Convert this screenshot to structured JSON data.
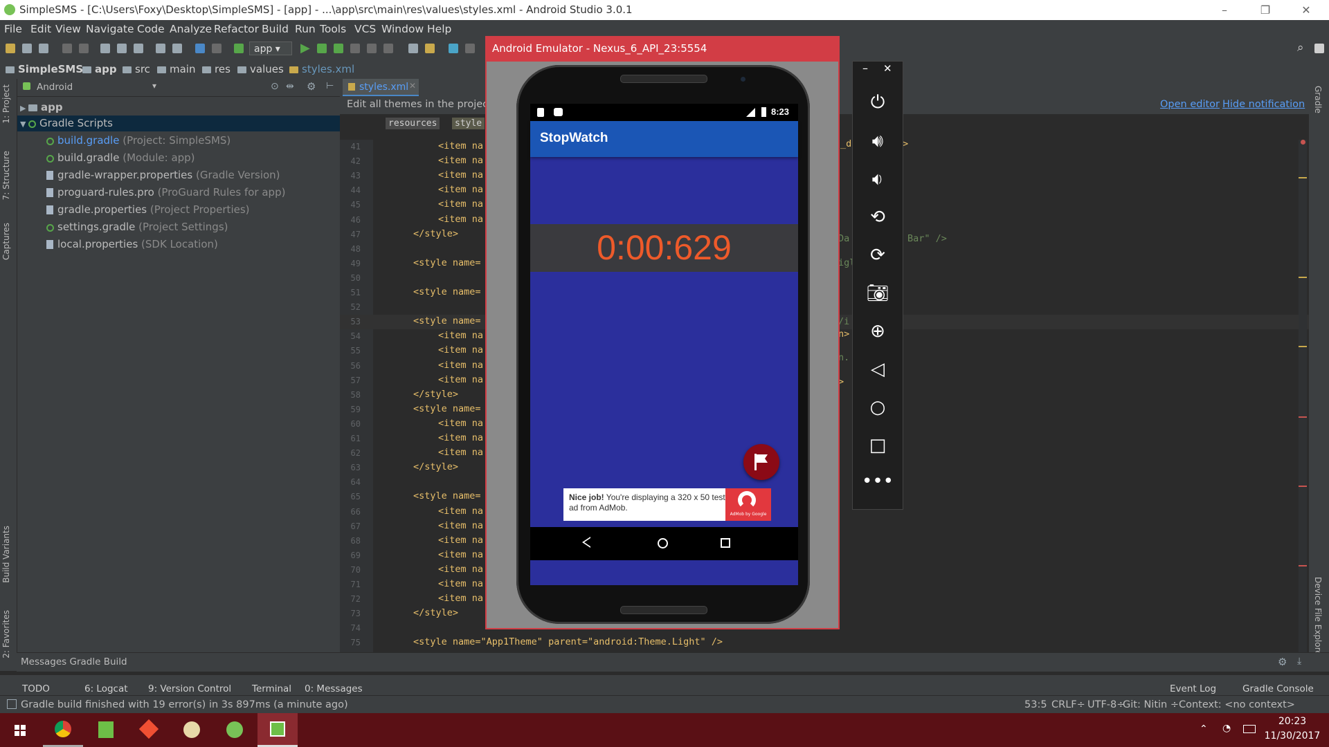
{
  "window": {
    "title": "SimpleSMS - [C:\\Users\\Foxy\\Desktop\\SimpleSMS] - [app] - ...\\app\\src\\main\\res\\values\\styles.xml - Android Studio 3.0.1",
    "minimize": "–",
    "maximize": "❐",
    "close": "✕"
  },
  "menu": [
    "File",
    "Edit",
    "View",
    "Navigate",
    "Code",
    "Analyze",
    "Refactor",
    "Build",
    "Run",
    "Tools",
    "VCS",
    "Window",
    "Help"
  ],
  "toolbar": {
    "run_config": "app"
  },
  "breadcrumb": [
    "SimpleSMS",
    "app",
    "src",
    "main",
    "res",
    "values",
    "styles.xml"
  ],
  "left_tabs": [
    "1: Project",
    "7: Structure",
    "Captures",
    "Build Variants",
    "2: Favorites"
  ],
  "right_tabs": [
    "Gradle",
    "Device File Explorer"
  ],
  "project": {
    "view": "Android",
    "tree": [
      {
        "label": "app",
        "hint": ""
      },
      {
        "label": "Gradle Scripts",
        "hint": ""
      },
      {
        "label": "build.gradle",
        "hint": "(Project: SimpleSMS)"
      },
      {
        "label": "build.gradle",
        "hint": "(Module: app)"
      },
      {
        "label": "gradle-wrapper.properties",
        "hint": "(Gradle Version)"
      },
      {
        "label": "proguard-rules.pro",
        "hint": "(ProGuard Rules for app)"
      },
      {
        "label": "gradle.properties",
        "hint": "(Project Properties)"
      },
      {
        "label": "settings.gradle",
        "hint": "(Project Settings)"
      },
      {
        "label": "local.properties",
        "hint": "(SDK Location)"
      }
    ]
  },
  "editor": {
    "tab": "styles.xml",
    "notification": "Edit all themes in the project i",
    "open_editor": "Open editor",
    "hide_notification": "Hide notification",
    "xml_crumbs": [
      "resources",
      "style"
    ],
    "right_fragments": [
      "_da",
      "&gt;",
      "Da",
      "Bar\" />",
      "igl",
      "/i",
      "n&gt;",
      "n.",
      "&gt;"
    ],
    "lines": [
      {
        "n": "41",
        "t": "<item na"
      },
      {
        "n": "42",
        "t": "<item na"
      },
      {
        "n": "43",
        "t": "<item na"
      },
      {
        "n": "44",
        "t": "<item na"
      },
      {
        "n": "45",
        "t": "<item na"
      },
      {
        "n": "46",
        "t": "<item na"
      },
      {
        "n": "47",
        "t": "</style>"
      },
      {
        "n": "48",
        "t": ""
      },
      {
        "n": "49",
        "t": "<style name="
      },
      {
        "n": "50",
        "t": ""
      },
      {
        "n": "51",
        "t": "<style name="
      },
      {
        "n": "52",
        "t": ""
      },
      {
        "n": "53",
        "t": "<style name="
      },
      {
        "n": "54",
        "t": "<item na"
      },
      {
        "n": "55",
        "t": "<item na"
      },
      {
        "n": "56",
        "t": "<item na"
      },
      {
        "n": "57",
        "t": "<item na"
      },
      {
        "n": "58",
        "t": "</style>"
      },
      {
        "n": "59",
        "t": "<style name="
      },
      {
        "n": "60",
        "t": "<item na"
      },
      {
        "n": "61",
        "t": "<item na"
      },
      {
        "n": "62",
        "t": "<item na"
      },
      {
        "n": "63",
        "t": "</style>"
      },
      {
        "n": "64",
        "t": ""
      },
      {
        "n": "65",
        "t": "<style name="
      },
      {
        "n": "66",
        "t": "<item na"
      },
      {
        "n": "67",
        "t": "<item na"
      },
      {
        "n": "68",
        "t": "<item na"
      },
      {
        "n": "69",
        "t": "<item na"
      },
      {
        "n": "70",
        "t": "<item na"
      },
      {
        "n": "71",
        "t": "<item na"
      },
      {
        "n": "72",
        "t": "<item na"
      },
      {
        "n": "73",
        "t": "</style>"
      },
      {
        "n": "74",
        "t": ""
      },
      {
        "n": "75",
        "t": "<style name=\"App1Theme\" parent=\"android:Theme.Light\" />"
      }
    ]
  },
  "messages_header": "Messages Gradle Build",
  "tool_windows": [
    "TODO",
    "6: Logcat",
    "9: Version Control",
    "Terminal",
    "0: Messages",
    "Event Log",
    "Gradle Console"
  ],
  "status": {
    "message": "Gradle build finished with 19 error(s) in 3s 897ms (a minute ago)",
    "position": "53:5",
    "line_sep": "CRLF÷",
    "encoding": "UTF-8÷",
    "git": "Git: Nitin ÷",
    "context": "Context: <no context>"
  },
  "emulator": {
    "title": "Android Emulator - Nexus_6_API_23:5554",
    "clock": "8:23",
    "app_title": "StopWatch",
    "timer": "0:00:629",
    "ad_bold": "Nice job!",
    "ad_text": " You're displaying a 320 x 50 test ad from AdMob.",
    "ad_brand": "AdMob by Google"
  },
  "taskbar": {
    "time": "20:23",
    "date": "11/30/2017"
  },
  "colors": {
    "accent_red": "#d23d45",
    "appbar_blue": "#1b56b5",
    "timer_orange": "#ee5a2a",
    "screen_blue": "#2b2f9c"
  }
}
